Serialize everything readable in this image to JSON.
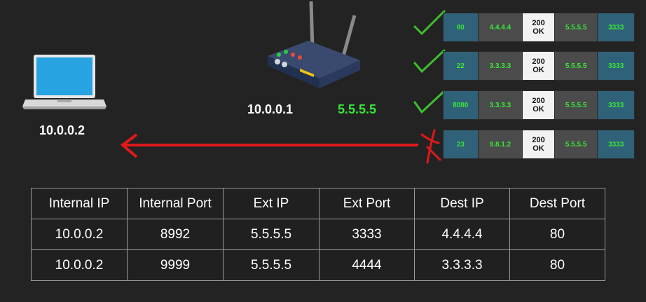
{
  "devices": {
    "client_ip": "10.0.0.2",
    "router_internal_ip": "10.0.0.1",
    "router_external_ip": "5.5.5.5"
  },
  "icons": {
    "laptop": "laptop-icon",
    "router": "router-icon",
    "check": "checkmark-icon",
    "cross": "cross-icon",
    "arrow": "arrow-left-icon"
  },
  "colors": {
    "background": "#232323",
    "accent_green": "#39e639",
    "check_green": "#3fbf2f",
    "arrow_red": "#e01919",
    "port_cell": "#2f6178",
    "ip_cell": "#4b4b4b"
  },
  "packets": [
    {
      "src_port": "80",
      "src_ip": "4.4.4.4",
      "body_1": "200",
      "body_2": "OK",
      "dst_ip": "5.5.5.5",
      "dst_port": "3333",
      "status": "accepted"
    },
    {
      "src_port": "22",
      "src_ip": "3.3.3.3",
      "body_1": "200",
      "body_2": "OK",
      "dst_ip": "5.5.5.5",
      "dst_port": "3333",
      "status": "accepted"
    },
    {
      "src_port": "8080",
      "src_ip": "3.3.3.3",
      "body_1": "200",
      "body_2": "OK",
      "dst_ip": "5.5.5.5",
      "dst_port": "3333",
      "status": "accepted"
    },
    {
      "src_port": "23",
      "src_ip": "9.8.1.2",
      "body_1": "200",
      "body_2": "OK",
      "dst_ip": "5.5.5.5",
      "dst_port": "3333",
      "status": "rejected"
    }
  ],
  "nat_table": {
    "headers": [
      "Internal IP",
      "Internal Port",
      "Ext IP",
      "Ext Port",
      "Dest IP",
      "Dest Port"
    ],
    "rows": [
      [
        "10.0.0.2",
        "8992",
        "5.5.5.5",
        "3333",
        "4.4.4.4",
        "80"
      ],
      [
        "10.0.0.2",
        "9999",
        "5.5.5.5",
        "4444",
        "3.3.3.3",
        "80"
      ]
    ]
  }
}
